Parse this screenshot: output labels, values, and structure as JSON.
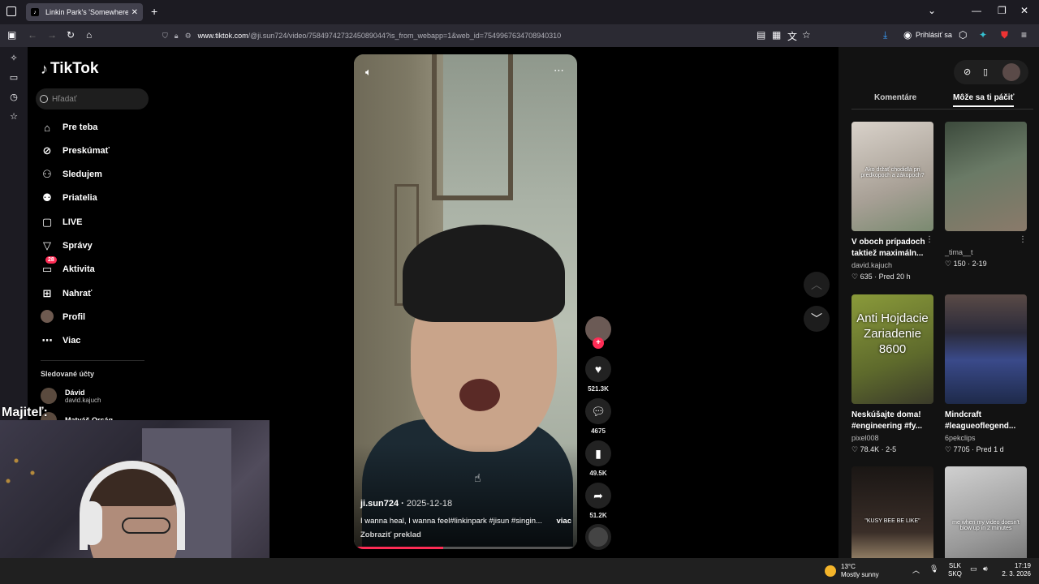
{
  "browser": {
    "tab_title": "Linkin Park's 'Somewhere I",
    "new_tab": "+",
    "url_domain": "www.tiktok.com",
    "url_path": "/@ji.sun724/video/7584974273245089044?is_from_webapp=1&web_id=7549967634708940310",
    "signin_label": "Prihlásiť sa"
  },
  "tiktok": {
    "logo": "TikTok",
    "search_placeholder": "Hľadať",
    "nav": [
      {
        "label": "Pre teba",
        "icon": "home-icon"
      },
      {
        "label": "Preskúmať",
        "icon": "compass-icon"
      },
      {
        "label": "Sledujem",
        "icon": "following-icon"
      },
      {
        "label": "Priatelia",
        "icon": "friends-icon"
      },
      {
        "label": "LIVE",
        "icon": "live-icon"
      },
      {
        "label": "Správy",
        "icon": "messages-icon"
      },
      {
        "label": "Aktivita",
        "icon": "activity-icon",
        "badge": "28"
      },
      {
        "label": "Nahrať",
        "icon": "upload-icon"
      },
      {
        "label": "Profil",
        "icon": "profile-icon"
      },
      {
        "label": "Viac",
        "icon": "more-icon"
      }
    ],
    "followed_title": "Sledované účty",
    "followed": [
      {
        "name": "Dávid",
        "username": "david.kajuch"
      },
      {
        "name": "Matyáš Orság",
        "username": ""
      }
    ]
  },
  "overlay": {
    "owner_label": "Majiteľ:"
  },
  "video": {
    "author": "ji.sun724",
    "date": "2025-12-18",
    "description": "I wanna heal, I wanna feel#linkinpark #jisun #singin...",
    "more_label": "viac",
    "translate_label": "Zobraziť preklad",
    "progress": 0.4
  },
  "actions": {
    "likes": "521.3K",
    "comments": "4675",
    "saves": "49.5K",
    "shares": "51.2K"
  },
  "panel": {
    "tabs": [
      "Komentáre",
      "Môže sa ti páčiť"
    ],
    "active_tab": 1,
    "cards": [
      {
        "title": "V oboch prípadoch taktiež maximáln...",
        "author": "david.kajuch",
        "stats": "635 · Pred 20 h",
        "thumb_caption": "Ako držať chodidlá pri predkopoch a zákopoch?",
        "thumb_color": "#c9c0b8"
      },
      {
        "title": "",
        "author": "_tima__t",
        "stats": "150 · 2-19",
        "thumb_caption": "",
        "thumb_color": "#5e6a62"
      },
      {
        "title": "Neskúšajte doma! #engineering #fy...",
        "author": "pixel008",
        "stats": "78.4K · 2-5",
        "thumb_caption": "Anti Hojdacie Zariadenie 8600",
        "thumb_color": "#6b7a3a"
      },
      {
        "title": "Mindcraft #leagueoflegend...",
        "author": "6pekclips",
        "stats": "7705 · Pred 1 d",
        "thumb_caption": "",
        "thumb_color": "#2e3a66"
      },
      {
        "title": "",
        "author": "",
        "stats": "",
        "thumb_caption": "\"KUSY BEE BE LIKE\"",
        "thumb_color": "#2a2220"
      },
      {
        "title": "",
        "author": "",
        "stats": "",
        "thumb_caption": "me when my video doesn't blow up in 2 minutes",
        "thumb_color": "#9a9a9a"
      }
    ]
  },
  "taskbar": {
    "temp": "13°C",
    "weather": "Mostly sunny",
    "lang1": "SLK",
    "lang2": "SKQ",
    "time": "17:19",
    "date": "2. 3. 2026"
  },
  "colors": {
    "accent": "#fe2c55",
    "panel_bg": "#121212"
  }
}
